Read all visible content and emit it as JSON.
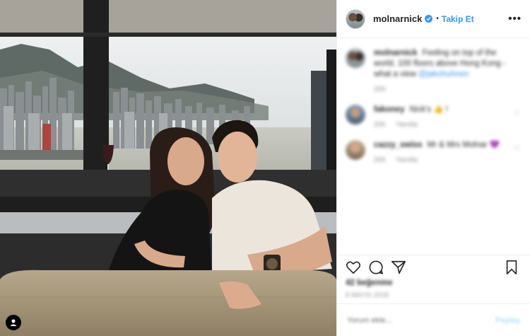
{
  "post": {
    "header": {
      "username": "molnarnick",
      "separator": "•",
      "follow_label": "Takip Et",
      "more_glyph": "•••"
    },
    "caption": {
      "username": "molnarnick",
      "text": "Feeling on top of the world. 100 floors above Hong Kong - what a view",
      "mention": "@jakohuhnen",
      "time": "20h"
    },
    "comments": [
      {
        "username": "fakoney",
        "text": "Nick's 👍 !",
        "time": "20h",
        "reply_label": "Yanıtla"
      },
      {
        "username": "cazzy_swiss",
        "text": "Mr & Mrs Molnar 💜",
        "time": "20h",
        "reply_label": "Yanıtla"
      }
    ],
    "likes": "42 beğenme",
    "date": "8 MAYIS 2018",
    "comment_input_placeholder": "Yorum ekle...",
    "post_button_label": "Paylaş",
    "icons": {
      "like": "heart-icon",
      "comment": "comment-icon",
      "share": "share-icon",
      "save": "bookmark-icon",
      "verified": "verified-badge-icon",
      "user_tag": "user-tag-icon"
    },
    "colors": {
      "accent": "#3897f0",
      "text": "#262626",
      "muted": "#8e8e8e",
      "border": "#efefef"
    }
  }
}
